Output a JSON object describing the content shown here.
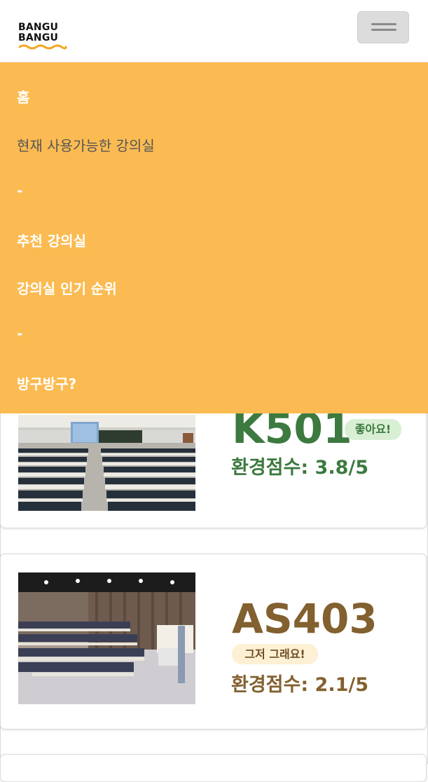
{
  "header": {
    "logo_line1": "BANGU",
    "logo_line2": "BANGU"
  },
  "nav": {
    "items": [
      {
        "label": "홈"
      },
      {
        "label": "현재 사용가능한 강의실"
      },
      {
        "label": "-"
      },
      {
        "label": "추천 강의실"
      },
      {
        "label": "강의실 인기 순위"
      },
      {
        "label": "-"
      },
      {
        "label": "방구방구?"
      }
    ]
  },
  "rooms": [
    {
      "name": "K501",
      "badge": "좋아요!",
      "score_text": "환경점수: 3.8/5",
      "score": 3.8
    },
    {
      "name": "AS403",
      "badge": "그저 그래요!",
      "score_text": "환경점수: 2.1/5",
      "score": 2.1
    }
  ],
  "colors": {
    "menu_bg": "#fbbb52",
    "good_green": "#3c7a3f",
    "good_badge": "#d9efd4",
    "mid_brown": "#82602f",
    "mid_badge": "#fdf0d4"
  }
}
